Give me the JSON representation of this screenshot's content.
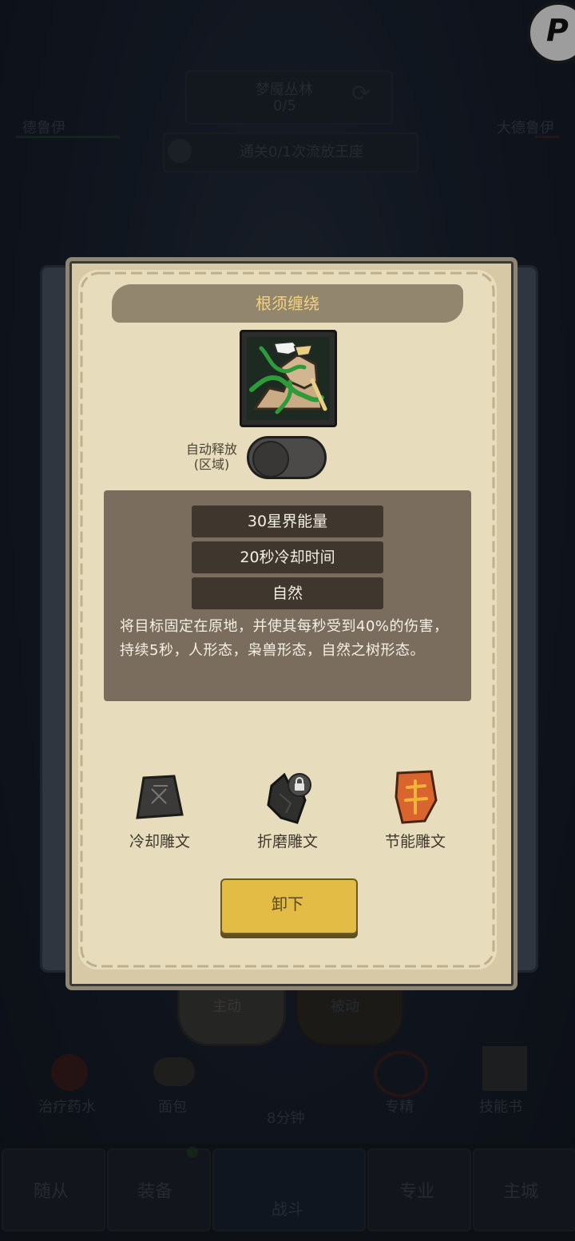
{
  "background": {
    "zone_name": "梦魇丛林",
    "zone_progress": "0/5",
    "left_player": "德鲁伊",
    "right_player": "大德鲁伊",
    "quest": "通关0/1次流放王座",
    "tabs": [
      "主动",
      "被动"
    ],
    "items": [
      "治疗药水",
      "面包",
      "专精",
      "技能书"
    ],
    "timer": "8分钟",
    "nav": [
      "随从",
      "装备",
      "战斗",
      "专业",
      "主城"
    ]
  },
  "dialog": {
    "title": "根须缠绕",
    "skill_icon": "root-entangle-icon",
    "auto_cast_label": "自动释放",
    "auto_cast_sub": "(区域)",
    "auto_cast_on": false,
    "stats": [
      "30星界能量",
      "20秒冷却时间",
      "自然"
    ],
    "description": "将目标固定在原地，并使其每秒受到40%的伤害，持续5秒，人形态，枭兽形态，自然之树形态。",
    "runes": [
      {
        "label": "冷却雕文",
        "icon": "cooldown-rune-icon",
        "locked": false
      },
      {
        "label": "折磨雕文",
        "icon": "torment-rune-icon",
        "locked": true
      },
      {
        "label": "节能雕文",
        "icon": "energy-saving-rune-icon",
        "locked": false
      }
    ],
    "unequip_label": "卸下"
  },
  "colors": {
    "parchment": "#e7dcbc",
    "title_gold": "#f3d27d",
    "button_yellow": "#e2bc44",
    "info_box": "#7a6d5e",
    "stat_bar": "#3f362d",
    "rune_orange": "#d9652e"
  }
}
